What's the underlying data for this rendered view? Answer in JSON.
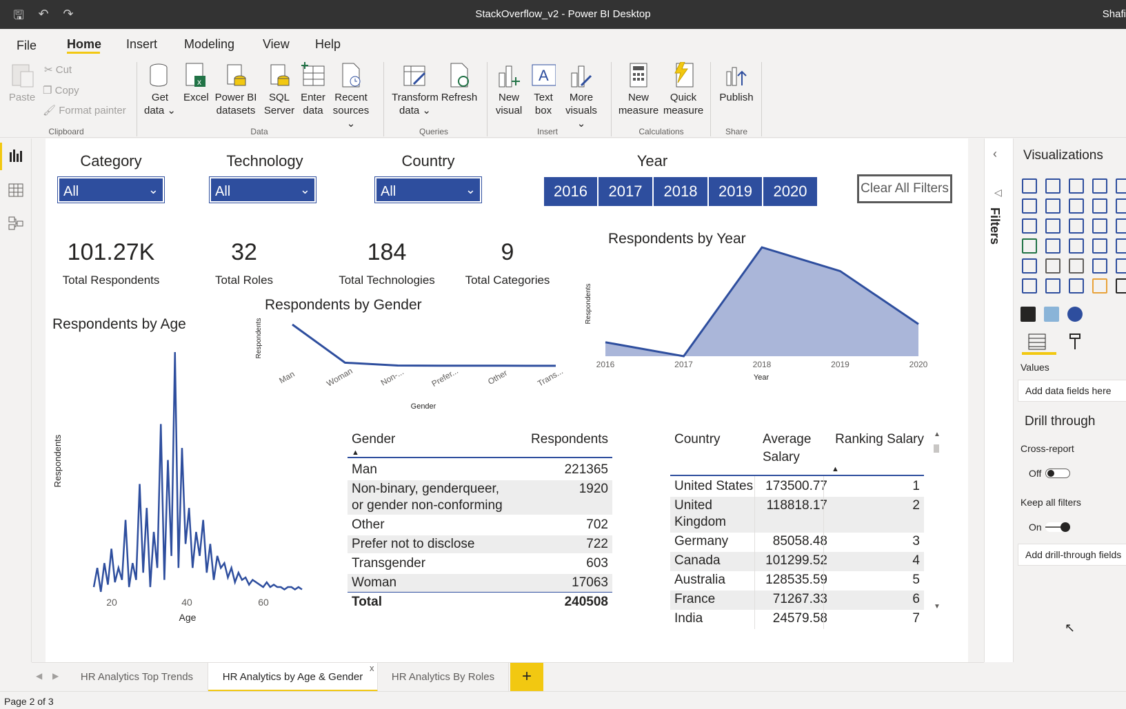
{
  "window": {
    "title": "StackOverflow_v2 - Power BI Desktop",
    "user": "Shafi"
  },
  "menu": [
    "File",
    "Home",
    "Insert",
    "Modeling",
    "View",
    "Help"
  ],
  "ribbon": {
    "clipboard": {
      "paste": "Paste",
      "cut": "Cut",
      "copy": "Copy",
      "format_painter": "Format painter",
      "group": "Clipboard"
    },
    "data": {
      "get_data": [
        "Get",
        "data"
      ],
      "excel": "Excel",
      "pbi_datasets": [
        "Power BI",
        "datasets"
      ],
      "sql": [
        "SQL",
        "Server"
      ],
      "enter": [
        "Enter",
        "data"
      ],
      "recent": [
        "Recent",
        "sources"
      ],
      "group": "Data"
    },
    "queries": {
      "transform": [
        "Transform",
        "data"
      ],
      "refresh": "Refresh",
      "group": "Queries"
    },
    "insert": {
      "new_visual": [
        "New",
        "visual"
      ],
      "text_box": [
        "Text",
        "box"
      ],
      "more_visuals": [
        "More",
        "visuals"
      ],
      "group": "Insert"
    },
    "calculations": {
      "new_measure": [
        "New",
        "measure"
      ],
      "quick_measure": [
        "Quick",
        "measure"
      ],
      "group": "Calculations"
    },
    "share": {
      "publish": "Publish",
      "group": "Share"
    }
  },
  "slicers": {
    "category": {
      "label": "Category",
      "value": "All"
    },
    "technology": {
      "label": "Technology",
      "value": "All"
    },
    "country": {
      "label": "Country",
      "value": "All"
    },
    "year": {
      "label": "Year",
      "values": [
        "2016",
        "2017",
        "2018",
        "2019",
        "2020"
      ]
    },
    "clear": "Clear All Filters"
  },
  "cards": [
    {
      "value": "101.27K",
      "label": "Total Respondents"
    },
    {
      "value": "32",
      "label": "Total Roles"
    },
    {
      "value": "184",
      "label": "Total Technologies"
    },
    {
      "value": "9",
      "label": "Total Categories"
    }
  ],
  "visual_titles": {
    "age": "Respondents by Age",
    "gender": "Respondents by Gender",
    "year": "Respondents by Year"
  },
  "gender_table": {
    "headers": [
      "Gender",
      "Respondents"
    ],
    "rows": [
      [
        "Man",
        "221365"
      ],
      [
        "Non-binary, genderqueer,",
        "1920"
      ],
      [
        "or gender non-conforming",
        ""
      ],
      [
        "Other",
        "702"
      ],
      [
        "Prefer not to disclose",
        "722"
      ],
      [
        "Transgender",
        "603"
      ],
      [
        "Woman",
        "17063"
      ]
    ],
    "total": [
      "Total",
      "240508"
    ]
  },
  "country_table": {
    "headers": [
      "Country",
      "Average",
      "Salary",
      "Ranking Salary"
    ],
    "rows": [
      [
        "United States",
        "173500.77",
        "1"
      ],
      [
        "United",
        "118818.17",
        "2"
      ],
      [
        "Kingdom",
        "",
        ""
      ],
      [
        "Germany",
        "85058.48",
        "3"
      ],
      [
        "Canada",
        "101299.52",
        "4"
      ],
      [
        "Australia",
        "128535.59",
        "5"
      ],
      [
        "France",
        "71267.33",
        "6"
      ],
      [
        "India",
        "24579.58",
        "7"
      ]
    ]
  },
  "panes": {
    "filters": "Filters",
    "visualizations": "Visualizations",
    "values": "Values",
    "add_fields": "Add data fields here",
    "drill": "Drill through",
    "cross": "Cross-report",
    "off": "Off",
    "keep": "Keep all filters",
    "on": "On",
    "add_drill": "Add drill-through fields"
  },
  "tabs": [
    "HR Analytics Top Trends",
    "HR Analytics by Age & Gender",
    "HR Analytics By Roles"
  ],
  "tab_close": "x",
  "add_tab": "+",
  "status": "Page 2 of 3",
  "chart_data": [
    {
      "type": "area",
      "title": "Respondents by Year",
      "xlabel": "Year",
      "ylabel": "Respondents",
      "categories": [
        "2016",
        "2017",
        "2018",
        "2019",
        "2020"
      ],
      "values": [
        0.1,
        0.0,
        0.78,
        0.61,
        0.23
      ]
    },
    {
      "type": "line",
      "title": "Respondents by Gender",
      "xlabel": "Gender",
      "ylabel": "Respondents",
      "categories": [
        "Man",
        "Woman",
        "Non-...",
        "Prefer...",
        "Other",
        "Trans..."
      ],
      "values": [
        221365,
        17063,
        1920,
        722,
        702,
        603
      ]
    },
    {
      "type": "line",
      "title": "Respondents by Age",
      "xlabel": "Age",
      "ylabel": "Respondents",
      "x_ticks": [
        "20",
        "40",
        "60"
      ],
      "values": [
        0.02,
        0.1,
        0.0,
        0.12,
        0.03,
        0.18,
        0.04,
        0.1,
        0.05,
        0.3,
        0.02,
        0.12,
        0.05,
        0.45,
        0.08,
        0.35,
        0.02,
        0.25,
        0.1,
        0.7,
        0.05,
        0.55,
        0.15,
        1.0,
        0.1,
        0.6,
        0.2,
        0.35,
        0.1,
        0.25,
        0.15,
        0.3,
        0.08,
        0.2,
        0.05,
        0.15,
        0.1,
        0.12,
        0.06,
        0.1,
        0.04,
        0.08,
        0.05,
        0.06,
        0.03,
        0.05,
        0.04,
        0.03,
        0.02,
        0.04,
        0.02,
        0.03,
        0.02,
        0.02,
        0.01,
        0.02,
        0.02,
        0.01,
        0.02,
        0.01
      ]
    }
  ]
}
